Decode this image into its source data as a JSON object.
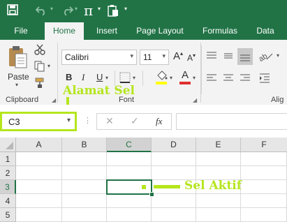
{
  "tabs": [
    "File",
    "Home",
    "Insert",
    "Page Layout",
    "Formulas",
    "Data"
  ],
  "active_tab": "Home",
  "ribbon": {
    "paste_label": "Paste",
    "clipboard_label": "Clipboard",
    "font_label": "Font",
    "align_label": "Alig",
    "font_name": "Calibri",
    "font_size": "11",
    "bold": "B",
    "italic": "I",
    "underline": "U",
    "grow_font": "A",
    "shrink_font": "A",
    "font_color_glyph": "A"
  },
  "formula_bar": {
    "name_box": "C3",
    "fx": "fx"
  },
  "grid": {
    "columns": [
      "A",
      "B",
      "C",
      "D",
      "E",
      "F"
    ],
    "rows": [
      "1",
      "2",
      "3",
      "4",
      "5"
    ],
    "active_cell": "C3"
  },
  "annotations": {
    "name_box_label": "Alamat Sel",
    "active_cell_label": "Sel Aktif",
    "accent_color": "#b5e61d"
  },
  "colors": {
    "excel_green": "#217346",
    "ribbon_bg": "#f3f3f3"
  },
  "icons": [
    "save-icon",
    "undo-icon",
    "redo-icon",
    "pi-icon",
    "paste-special-icon",
    "cut-icon",
    "copy-icon",
    "format-painter-icon",
    "border-icon",
    "fill-color-icon",
    "font-color-icon",
    "orientation-icon",
    "align-icon",
    "cancel-icon",
    "enter-icon",
    "function-icon"
  ]
}
